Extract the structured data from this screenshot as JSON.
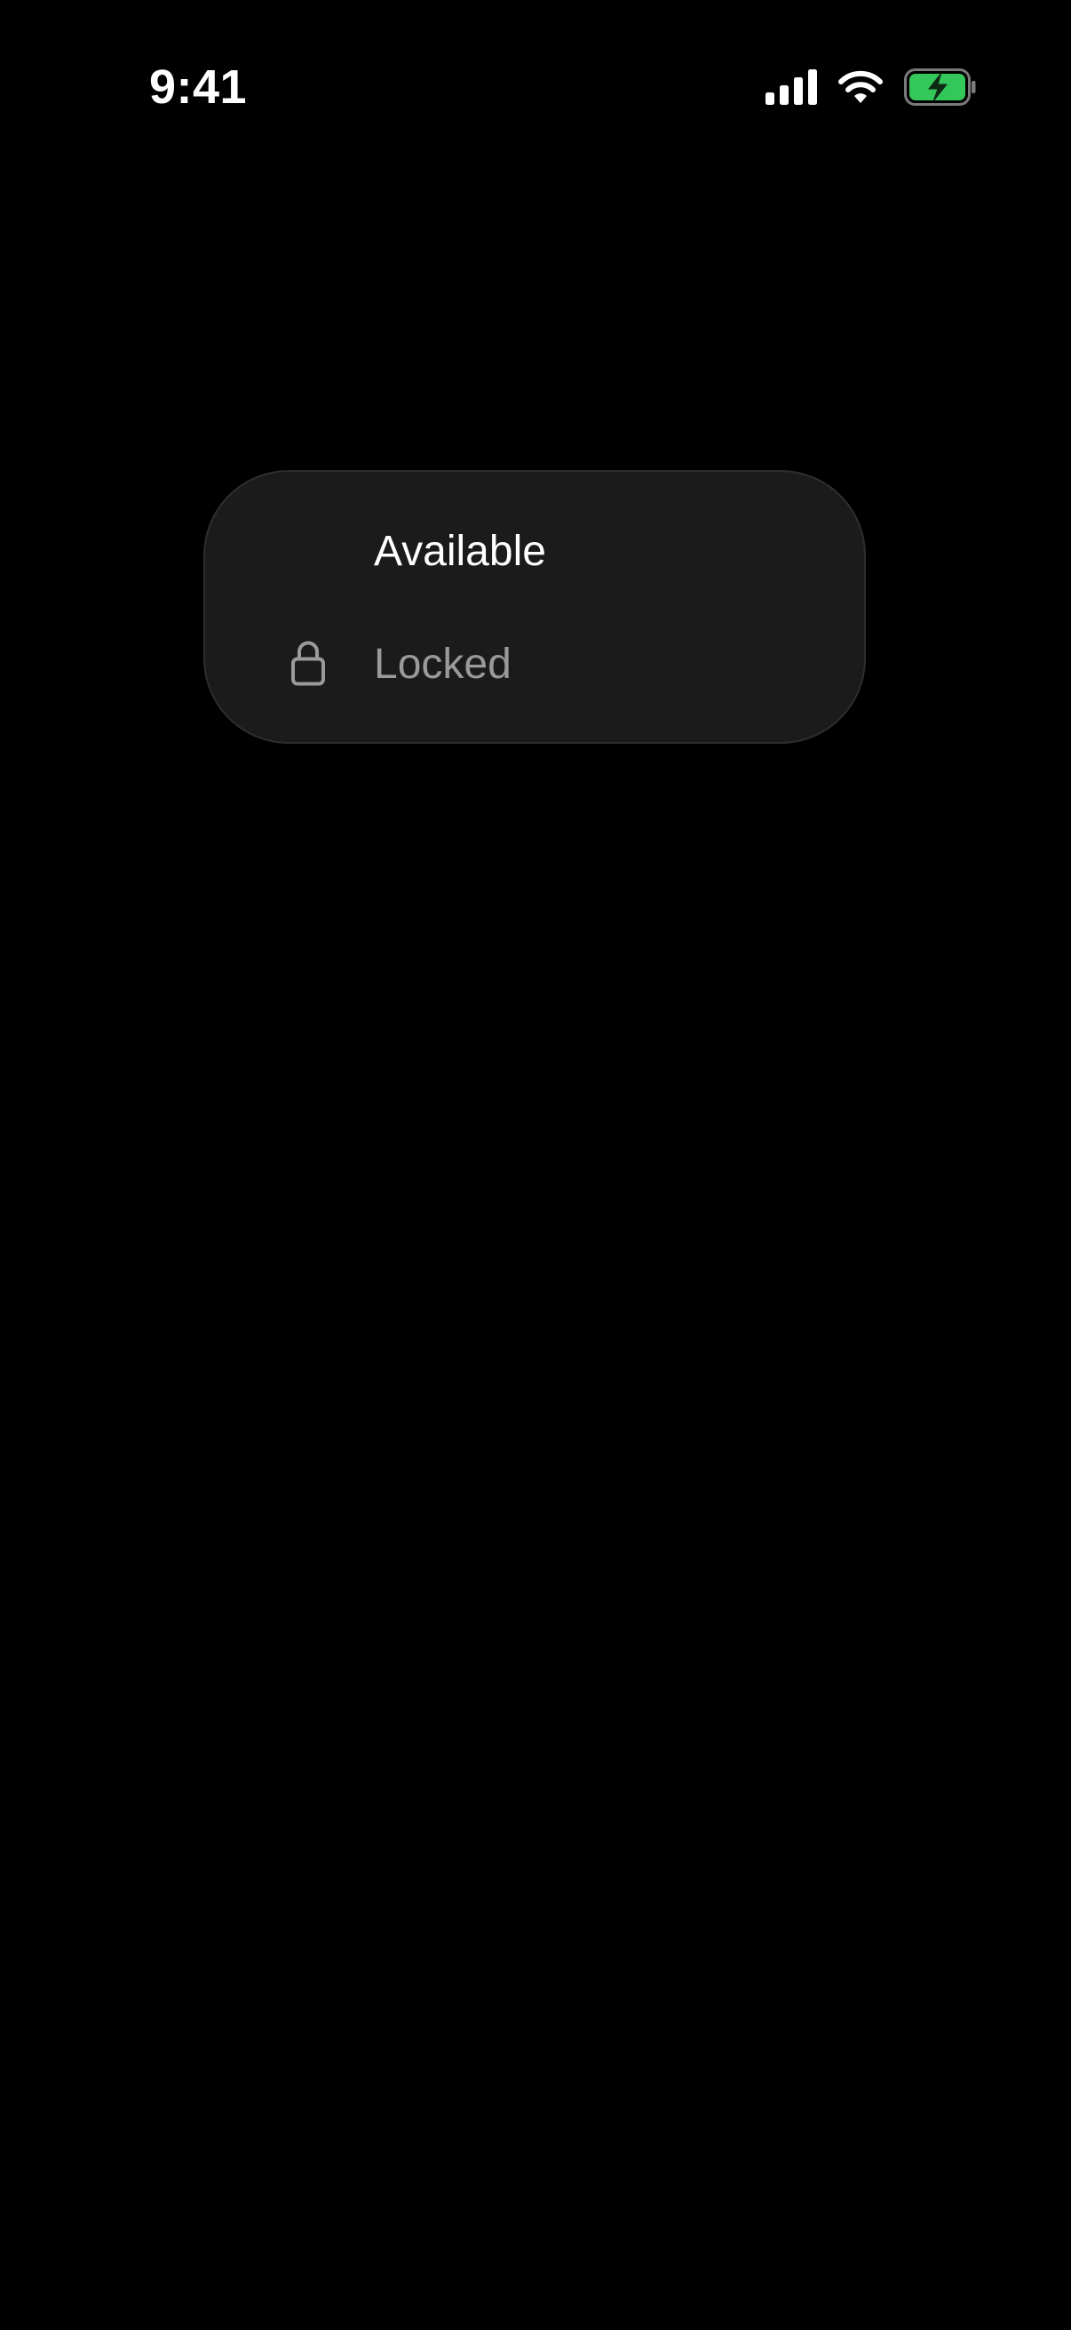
{
  "status_bar": {
    "time": "9:41",
    "icons": [
      "cellular-signal-icon",
      "wifi-icon",
      "battery-charging-icon"
    ],
    "battery_color": "#34c759"
  },
  "menu": {
    "items": [
      {
        "label": "Available",
        "icon": null,
        "state": "enabled"
      },
      {
        "label": "Locked",
        "icon": "lock-icon",
        "state": "disabled"
      }
    ]
  },
  "colors": {
    "background": "#000000",
    "card": "#1b1b1b",
    "text_primary": "#ffffff",
    "text_disabled": "#9a9a9a"
  }
}
